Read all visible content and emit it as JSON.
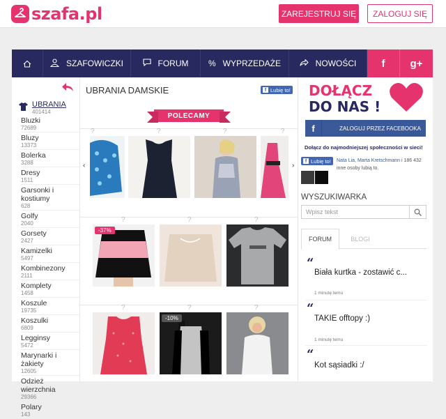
{
  "header": {
    "logo_text": "szafa.pl",
    "register_label": "ZAREJESTRUJ SIĘ",
    "login_label": "ZALOGUJ SIĘ"
  },
  "nav": {
    "items": [
      {
        "label": "SZAFOWICZKI",
        "icon": "user-hanger-icon"
      },
      {
        "label": "FORUM",
        "icon": "chat-icon"
      },
      {
        "label": "WYPRZEDAŻE",
        "icon": "percent-icon"
      },
      {
        "label": "NOWOŚCI",
        "icon": "share-arrow-icon"
      }
    ],
    "social": [
      "f",
      "g+"
    ]
  },
  "sidebar": {
    "active": {
      "name": "UBRANIA",
      "count": "401414"
    },
    "categories": [
      {
        "name": "Bluzki",
        "count": "72689"
      },
      {
        "name": "Bluzy",
        "count": "13373"
      },
      {
        "name": "Bolerka",
        "count": "3288"
      },
      {
        "name": "Dresy",
        "count": "1511"
      },
      {
        "name": "Garsonki i kostiumy",
        "count": "628"
      },
      {
        "name": "Golfy",
        "count": "2040"
      },
      {
        "name": "Gorsety",
        "count": "2427"
      },
      {
        "name": "Kamizelki",
        "count": "5497"
      },
      {
        "name": "Kombinezony",
        "count": "2111"
      },
      {
        "name": "Komplety",
        "count": "1458"
      },
      {
        "name": "Koszule",
        "count": "19735"
      },
      {
        "name": "Koszulki",
        "count": "6809"
      },
      {
        "name": "Legginsy",
        "count": "5472"
      },
      {
        "name": "Marynarki i żakiety",
        "count": "12605"
      },
      {
        "name": "Odzież wierzchnia",
        "count": "29366"
      },
      {
        "name": "Polary",
        "count": "143"
      }
    ]
  },
  "center": {
    "title": "UBRANIA DAMSKIE",
    "like_label": "Lubię to!",
    "recommended_label": "POLECAMY",
    "badges": [
      "-37%",
      "-10%"
    ]
  },
  "right": {
    "join_line1": "DOŁĄCZ",
    "join_line2": "DO NAS !",
    "fb_login_label": "ZALOGUJ PRZEZ FACEBOOKA",
    "community_text": "Dołącz do najmodniejszej społeczności w sieci!",
    "like_label": "Lubię to!",
    "likes_names": "Nata Lia, Marta Kretschmann",
    "likes_rest": " i 186 432 inne osoby lubią to.",
    "search_title": "WYSZUKIWARKA",
    "search_placeholder": "Wpisz tekst",
    "tab_forum": "FORUM",
    "tab_blogi": "BLOGI",
    "posts": [
      {
        "title": "Biała kurtka - zostawić c...",
        "time": "1 minutę temu"
      },
      {
        "title": "TAKIE offtopy :)",
        "time": "1 minutę temu"
      },
      {
        "title": "Kot sąsiadki :/",
        "time": ""
      }
    ]
  },
  "colors": {
    "brand_pink": "#e5336e",
    "nav_navy": "#28295f",
    "facebook_blue": "#3b5998"
  }
}
